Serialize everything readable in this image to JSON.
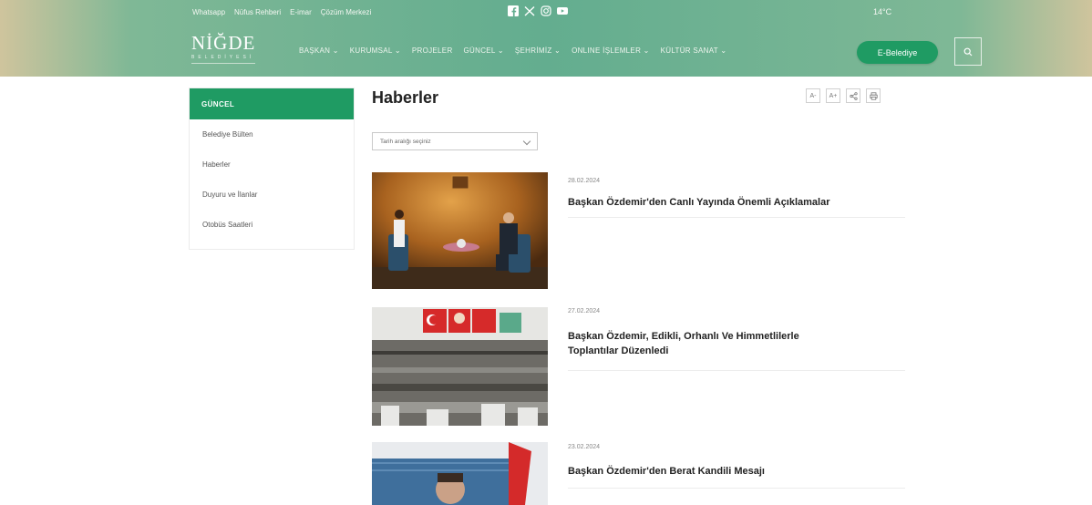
{
  "header": {
    "top_links": [
      "Whatsapp",
      "Nüfus Rehberi",
      "E-imar",
      "Çözüm Merkezi"
    ],
    "weather": "14°C",
    "logo_text": "NİĞDE",
    "logo_sub": "BELEDİYESİ",
    "nav": [
      "BAŞKAN ⌄",
      "KURUMSAL ⌄",
      "PROJELER",
      "GÜNCEL ⌄",
      "ŞEHRİMİZ ⌄",
      "ONLINE İŞLEMLER ⌄",
      "KÜLTÜR SANAT ⌄"
    ],
    "ebelediye_label": "E-Belediye",
    "social_icons": [
      "facebook-icon",
      "x-icon",
      "instagram-icon",
      "youtube-icon"
    ]
  },
  "sidebar": {
    "heading": "GÜNCEL",
    "items": [
      "Belediye Bülten",
      "Haberler",
      "Duyuru ve İlanlar",
      "Otobüs Saatleri"
    ]
  },
  "content": {
    "title": "Haberler",
    "tools": [
      "font-decrease-icon",
      "font-increase-icon",
      "share-icon",
      "print-icon"
    ],
    "tool_labels": [
      "A-",
      "A+"
    ],
    "date_filter_placeholder": "Tarih aralığı seçiniz",
    "news": [
      {
        "date": "28.02.2024",
        "title": "Başkan Özdemir'den Canlı Yayında Önemli Açıklamalar"
      },
      {
        "date": "27.02.2024",
        "title": "Başkan Özdemir, Edikli, Orhanlı Ve Himmetlilerle Toplantılar Düzenledi"
      },
      {
        "date": "23.02.2024",
        "title": "Başkan Özdemir'den Berat Kandili Mesajı"
      }
    ]
  },
  "colors": {
    "brand_green": "#1f9b63",
    "header_green": "#63ad8f",
    "header_sand": "#cfc49d"
  }
}
